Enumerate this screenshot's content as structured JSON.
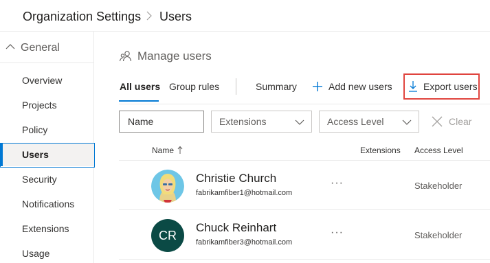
{
  "breadcrumb": {
    "parent": "Organization Settings",
    "current": "Users"
  },
  "sidebar": {
    "group_label": "General",
    "items": [
      {
        "label": "Overview",
        "selected": false
      },
      {
        "label": "Projects",
        "selected": false
      },
      {
        "label": "Policy",
        "selected": false
      },
      {
        "label": "Users",
        "selected": true
      },
      {
        "label": "Security",
        "selected": false
      },
      {
        "label": "Notifications",
        "selected": false
      },
      {
        "label": "Extensions",
        "selected": false
      },
      {
        "label": "Usage",
        "selected": false
      }
    ]
  },
  "page": {
    "title": "Manage users",
    "title_icon": "people-icon"
  },
  "tabs": [
    {
      "label": "All users",
      "active": true
    },
    {
      "label": "Group rules",
      "active": false
    }
  ],
  "actions": {
    "summary": "Summary",
    "add_new_users": "Add new users",
    "export_users": "Export users"
  },
  "filters": {
    "name_placeholder": "Name",
    "extensions_label": "Extensions",
    "access_level_label": "Access Level",
    "clear_label": "Clear"
  },
  "table": {
    "columns": {
      "name": "Name",
      "extensions": "Extensions",
      "access_level": "Access Level"
    },
    "sort": "ascending",
    "rows": [
      {
        "name": "Christie Church",
        "email": "fabrikamfiber1@hotmail.com",
        "avatar": "photo",
        "access_level": "Stakeholder"
      },
      {
        "name": "Chuck Reinhart",
        "email": "fabrikamfiber3@hotmail.com",
        "avatar_initials": "CR",
        "access_level": "Stakeholder"
      }
    ]
  },
  "colors": {
    "accent": "#0078d4",
    "highlight_box": "#e0443e",
    "initials_avatar": "#0b4a45"
  }
}
